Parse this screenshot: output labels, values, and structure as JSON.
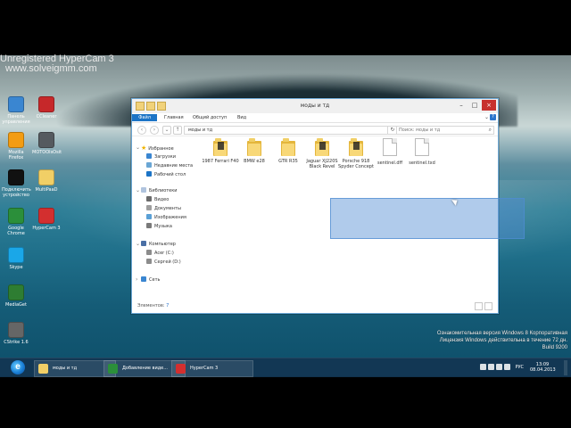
{
  "overlay": {
    "watermark_line1": "Unregistered HyperCam 3",
    "watermark_line2": "www.solveigmm.com"
  },
  "desktop": {
    "icons": [
      {
        "label": "Панель управления",
        "color": "#3a86d1"
      },
      {
        "label": "CCleaner",
        "color": "#c6282a"
      },
      {
        "label": "Mozilla Firefox",
        "color": "#f39c12"
      },
      {
        "label": "MOTOOlsOsit",
        "color": "#555a5f"
      },
      {
        "label": "Подключить устройство",
        "color": "#111111"
      },
      {
        "label": "MultiPaaD",
        "color": "#f1cf66"
      },
      {
        "label": "Google Chrome",
        "color": "#2b8f3a"
      },
      {
        "label": "HyperCam 3",
        "color": "#d32f2f"
      },
      {
        "label": "Skype",
        "color": "#1aa7e8"
      },
      {
        "label": "MediaGet",
        "color": "#2e7d32"
      },
      {
        "label": "CStrike 1.6",
        "color": "#666666"
      }
    ]
  },
  "explorer": {
    "title": "моды и тд",
    "ribbon_tabs": [
      "Файл",
      "Главная",
      "Общий доступ",
      "Вид"
    ],
    "path": "моды и тд",
    "search_placeholder": "Поиск: моды и тд",
    "nav": {
      "favorites": "Избранное",
      "downloads": "Загрузки",
      "recent": "Недавние места",
      "desktop": "Рабочий стол",
      "libraries": "Библиотеки",
      "video": "Видео",
      "documents": "Документы",
      "images": "Изображения",
      "music": "Музыка",
      "computer": "Компьютер",
      "drive_c": "Acer (C:)",
      "drive_d": "Сергей (D:)",
      "network": "Сеть"
    },
    "items": [
      {
        "label": "1987 Ferrari F40",
        "type": "folder"
      },
      {
        "label": "BMW e28",
        "type": "folder"
      },
      {
        "label": "GTR R35",
        "type": "folder"
      },
      {
        "label": "Jaguar XJ220S Black Revel",
        "type": "folder"
      },
      {
        "label": "Porsche 918 Spyder Concept",
        "type": "folder"
      },
      {
        "label": "sentinel.dff",
        "type": "file"
      },
      {
        "label": "sentinel.txd",
        "type": "file"
      }
    ],
    "status": {
      "label": "Элементов:",
      "count": "7"
    }
  },
  "system": {
    "watermark_line1": "Ознакомительная версия Windows 8 Корпоративная",
    "watermark_line2": "Лицензия Windows действительна в течение 72 дн.",
    "watermark_line3": "Build 9200"
  },
  "taskbar": {
    "buttons": [
      {
        "label": "моды и тд",
        "color": "#f1cf66"
      },
      {
        "label": "Добавление виде...",
        "color": "#2b8f3a"
      },
      {
        "label": "HyperCam 3",
        "color": "#d32f2f"
      }
    ],
    "tray": {
      "lang": "РУС",
      "time": "13:09",
      "date": "08.04.2013"
    }
  }
}
